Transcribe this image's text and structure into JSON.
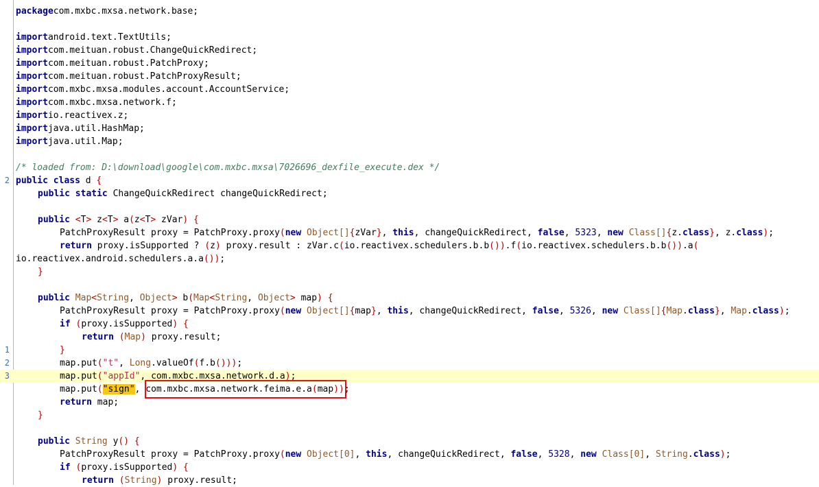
{
  "gutter": {
    "line_markers": [
      "2",
      "1",
      "2",
      "3"
    ]
  },
  "colors": {
    "keyword": "#00008b",
    "bracket": "#b30000",
    "type": "#8b5a2b",
    "string": "#b03060",
    "comment": "#3f7f5f",
    "highlight_line": "#ffffc8",
    "search_mark": "#f5c518",
    "annotation_box": "#e0121c"
  },
  "lines": [
    [
      [
        "kw",
        "package"
      ],
      [
        "",
        "com.mxbc.mxsa.network.base;"
      ]
    ],
    [],
    [
      [
        "kw",
        "import"
      ],
      [
        "",
        "android.text.TextUtils;"
      ]
    ],
    [
      [
        "kw",
        "import"
      ],
      [
        "",
        "com.meituan.robust.ChangeQuickRedirect;"
      ]
    ],
    [
      [
        "kw",
        "import"
      ],
      [
        "",
        "com.meituan.robust.PatchProxy;"
      ]
    ],
    [
      [
        "kw",
        "import"
      ],
      [
        "",
        "com.meituan.robust.PatchProxyResult;"
      ]
    ],
    [
      [
        "kw",
        "import"
      ],
      [
        "",
        "com.mxbc.mxsa.modules.account.AccountService;"
      ]
    ],
    [
      [
        "kw",
        "import"
      ],
      [
        "",
        "com.mxbc.mxsa.network.f;"
      ]
    ],
    [
      [
        "kw",
        "import"
      ],
      [
        "",
        "io.reactivex.z;"
      ]
    ],
    [
      [
        "kw",
        "import"
      ],
      [
        "",
        "java.util.HashMap;"
      ]
    ],
    [
      [
        "kw",
        "import"
      ],
      [
        "",
        "java.util.Map;"
      ]
    ],
    [],
    [
      [
        "cm",
        "/* loaded from: D:\\download\\google\\com.mxbc.mxsa\\7026696_dexfile_execute.dex */"
      ]
    ],
    [
      [
        "kw",
        "public class"
      ],
      [
        "",
        " d "
      ],
      [
        "br",
        "{"
      ]
    ],
    [
      [
        "",
        " "
      ],
      [
        "kw",
        "public static"
      ],
      [
        "",
        " ChangeQuickRedirect changeQuickRedirect;"
      ]
    ],
    [],
    [
      [
        "",
        " "
      ],
      [
        "kw",
        "public"
      ],
      [
        "",
        " "
      ],
      [
        "br",
        "<"
      ],
      [
        "",
        "T"
      ],
      [
        "br",
        ">"
      ],
      [
        "",
        " z"
      ],
      [
        "br",
        "<"
      ],
      [
        "",
        "T"
      ],
      [
        "br",
        ">"
      ],
      [
        "",
        " a"
      ],
      [
        "br",
        "("
      ],
      [
        "",
        "z"
      ],
      [
        "br",
        "<"
      ],
      [
        "",
        "T"
      ],
      [
        "br",
        ">"
      ],
      [
        "",
        " zVar"
      ],
      [
        "br",
        ")"
      ],
      [
        "",
        " "
      ],
      [
        "br",
        "{"
      ]
    ],
    [
      [
        "",
        " PatchProxyResult proxy = PatchProxy.proxy"
      ],
      [
        "br",
        "("
      ],
      [
        "kw",
        "new"
      ],
      [
        "",
        " "
      ],
      [
        "ty",
        "Object[]"
      ],
      [
        "br",
        "{"
      ],
      [
        "",
        "zVar"
      ],
      [
        "br",
        "}"
      ],
      [
        "",
        ", "
      ],
      [
        "kw",
        "this"
      ],
      [
        "",
        ", changeQuickRedirect, "
      ],
      [
        "kw",
        "false"
      ],
      [
        "",
        ", "
      ],
      [
        "num",
        "5323"
      ],
      [
        "",
        ", "
      ],
      [
        "kw",
        "new"
      ],
      [
        "",
        " "
      ],
      [
        "ty",
        "Class[]"
      ],
      [
        "br",
        "{"
      ],
      [
        "",
        "z."
      ],
      [
        "kw",
        "class"
      ],
      [
        "br",
        "}"
      ],
      [
        "",
        ", z."
      ],
      [
        "kw",
        "class"
      ],
      [
        "br",
        ")"
      ],
      [
        "",
        ";"
      ]
    ],
    [
      [
        "",
        " "
      ],
      [
        "kw",
        "return"
      ],
      [
        "",
        " proxy.isSupported ? "
      ],
      [
        "br",
        "("
      ],
      [
        "",
        "z"
      ],
      [
        "br",
        ")"
      ],
      [
        "",
        " proxy.result : zVar.c"
      ],
      [
        "br",
        "("
      ],
      [
        "",
        "io.reactivex.schedulers.b.b"
      ],
      [
        "br",
        "()"
      ],
      [
        "br",
        ")"
      ],
      [
        "",
        ".f"
      ],
      [
        "br",
        "("
      ],
      [
        "",
        "io.reactivex.schedulers.b.b"
      ],
      [
        "br",
        "()"
      ],
      [
        "br",
        ")"
      ],
      [
        "",
        ".a"
      ],
      [
        "br",
        "("
      ]
    ],
    [
      [
        "",
        "io.reactivex.android.schedulers.a.a"
      ],
      [
        "br",
        "()"
      ],
      [
        "br",
        ")"
      ],
      [
        "",
        ";"
      ]
    ],
    [
      [
        "",
        " "
      ],
      [
        "br",
        "}"
      ]
    ],
    [],
    [
      [
        "",
        " "
      ],
      [
        "kw",
        "public"
      ],
      [
        "",
        " "
      ],
      [
        "ty",
        "Map"
      ],
      [
        "br",
        "<"
      ],
      [
        "ty",
        "String"
      ],
      [
        "",
        ", "
      ],
      [
        "ty",
        "Object"
      ],
      [
        "br",
        ">"
      ],
      [
        "",
        " b"
      ],
      [
        "br",
        "("
      ],
      [
        "ty",
        "Map"
      ],
      [
        "br",
        "<"
      ],
      [
        "ty",
        "String"
      ],
      [
        "",
        ", "
      ],
      [
        "ty",
        "Object"
      ],
      [
        "br",
        ">"
      ],
      [
        "",
        " map"
      ],
      [
        "br",
        ")"
      ],
      [
        "",
        " "
      ],
      [
        "br",
        "{"
      ]
    ],
    [
      [
        "",
        " PatchProxyResult proxy = PatchProxy.proxy"
      ],
      [
        "br",
        "("
      ],
      [
        "kw",
        "new"
      ],
      [
        "",
        " "
      ],
      [
        "ty",
        "Object[]"
      ],
      [
        "br",
        "{"
      ],
      [
        "",
        "map"
      ],
      [
        "br",
        "}"
      ],
      [
        "",
        ", "
      ],
      [
        "kw",
        "this"
      ],
      [
        "",
        ", changeQuickRedirect, "
      ],
      [
        "kw",
        "false"
      ],
      [
        "",
        ", "
      ],
      [
        "num",
        "5326"
      ],
      [
        "",
        ", "
      ],
      [
        "kw",
        "new"
      ],
      [
        "",
        " "
      ],
      [
        "ty",
        "Class[]"
      ],
      [
        "br",
        "{"
      ],
      [
        "ty",
        "Map"
      ],
      [
        "",
        "."
      ],
      [
        "kw",
        "class"
      ],
      [
        "br",
        "}"
      ],
      [
        "",
        ", "
      ],
      [
        "ty",
        "Map"
      ],
      [
        "",
        "."
      ],
      [
        "kw",
        "class"
      ],
      [
        "br",
        ")"
      ],
      [
        "",
        ";"
      ]
    ],
    [
      [
        "",
        " "
      ],
      [
        "kw",
        "if"
      ],
      [
        "",
        " "
      ],
      [
        "br",
        "("
      ],
      [
        "",
        "proxy.isSupported"
      ],
      [
        "br",
        ")"
      ],
      [
        "",
        " "
      ],
      [
        "br",
        "{"
      ]
    ],
    [
      [
        "",
        " "
      ],
      [
        "kw",
        "return"
      ],
      [
        "",
        " "
      ],
      [
        "br",
        "("
      ],
      [
        "ty",
        "Map"
      ],
      [
        "br",
        ")"
      ],
      [
        "",
        " proxy.result;"
      ]
    ],
    [
      [
        "",
        " "
      ],
      [
        "br",
        "}"
      ]
    ],
    [
      [
        "",
        " map.put"
      ],
      [
        "br",
        "("
      ],
      [
        "str",
        "\"t\""
      ],
      [
        "",
        ", "
      ],
      [
        "ty",
        "Long"
      ],
      [
        "",
        ".valueOf"
      ],
      [
        "br",
        "("
      ],
      [
        "",
        "f.b"
      ],
      [
        "br",
        "()"
      ],
      [
        "br",
        "))"
      ],
      [
        "",
        ";"
      ]
    ],
    [
      [
        "",
        " map.put"
      ],
      [
        "br",
        "("
      ],
      [
        "str",
        "\"appId\""
      ],
      [
        "",
        ", com.mxbc.mxsa.network.d.a"
      ],
      [
        "br",
        ")"
      ],
      [
        "",
        ";"
      ]
    ],
    [
      [
        "",
        " map.put"
      ],
      [
        "br",
        "("
      ],
      [
        "mark",
        "\"sign\""
      ],
      [
        "",
        ", com.mxbc.mxsa.network.feima.e.a"
      ],
      [
        "br",
        "("
      ],
      [
        "",
        "map"
      ],
      [
        "br",
        "))"
      ],
      [
        "",
        ";"
      ]
    ],
    [
      [
        "",
        " "
      ],
      [
        "kw",
        "return"
      ],
      [
        "",
        " map;"
      ]
    ],
    [
      [
        "",
        " "
      ],
      [
        "br",
        "}"
      ]
    ],
    [],
    [
      [
        "",
        " "
      ],
      [
        "kw",
        "public"
      ],
      [
        "",
        " "
      ],
      [
        "ty",
        "String"
      ],
      [
        "",
        " y"
      ],
      [
        "br",
        "()"
      ],
      [
        "",
        " "
      ],
      [
        "br",
        "{"
      ]
    ],
    [
      [
        "",
        " PatchProxyResult proxy = PatchProxy.proxy"
      ],
      [
        "br",
        "("
      ],
      [
        "kw",
        "new"
      ],
      [
        "",
        " "
      ],
      [
        "ty",
        "Object[0]"
      ],
      [
        "",
        ", "
      ],
      [
        "kw",
        "this"
      ],
      [
        "",
        ", changeQuickRedirect, "
      ],
      [
        "kw",
        "false"
      ],
      [
        "",
        ", "
      ],
      [
        "num",
        "5328"
      ],
      [
        "",
        ", "
      ],
      [
        "kw",
        "new"
      ],
      [
        "",
        " "
      ],
      [
        "ty",
        "Class[0]"
      ],
      [
        "",
        ", "
      ],
      [
        "ty",
        "String"
      ],
      [
        "",
        "."
      ],
      [
        "kw",
        "class"
      ],
      [
        "br",
        ")"
      ],
      [
        "",
        ";"
      ]
    ],
    [
      [
        "",
        " "
      ],
      [
        "kw",
        "if"
      ],
      [
        "",
        " "
      ],
      [
        "br",
        "("
      ],
      [
        "",
        "proxy.isSupported"
      ],
      [
        "br",
        ")"
      ],
      [
        "",
        " "
      ],
      [
        "br",
        "{"
      ]
    ],
    [
      [
        "",
        " "
      ],
      [
        "kw",
        "return"
      ],
      [
        "",
        " "
      ],
      [
        "br",
        "("
      ],
      [
        "ty",
        "String"
      ],
      [
        "br",
        ")"
      ],
      [
        "",
        " proxy.result;"
      ]
    ]
  ]
}
